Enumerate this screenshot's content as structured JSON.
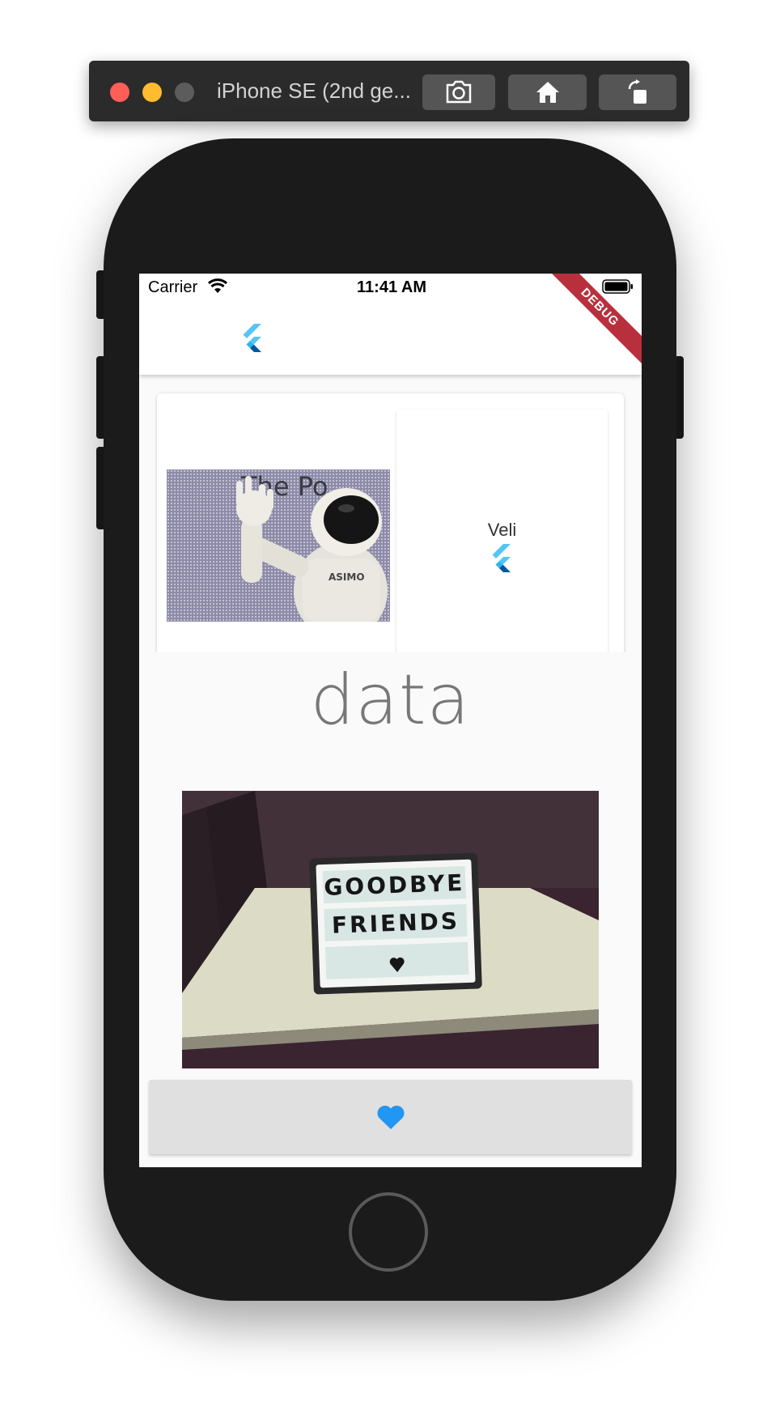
{
  "simulator": {
    "title": "iPhone SE (2nd ge..."
  },
  "status_bar": {
    "carrier": "Carrier",
    "time": "11:41 AM"
  },
  "debug_banner": "DEBUG",
  "card": {
    "label": "Veli"
  },
  "body_text": "data",
  "robot_photo_text": {
    "sign": "The Po",
    "chest": "ASIMO"
  },
  "board_photo_text": {
    "line1": "GOODBYE",
    "line2": "FRIENDS"
  },
  "colors": {
    "favorite_icon": "#2196f3",
    "debug": "#b8303d",
    "toolbar": "#2b2b2b"
  }
}
